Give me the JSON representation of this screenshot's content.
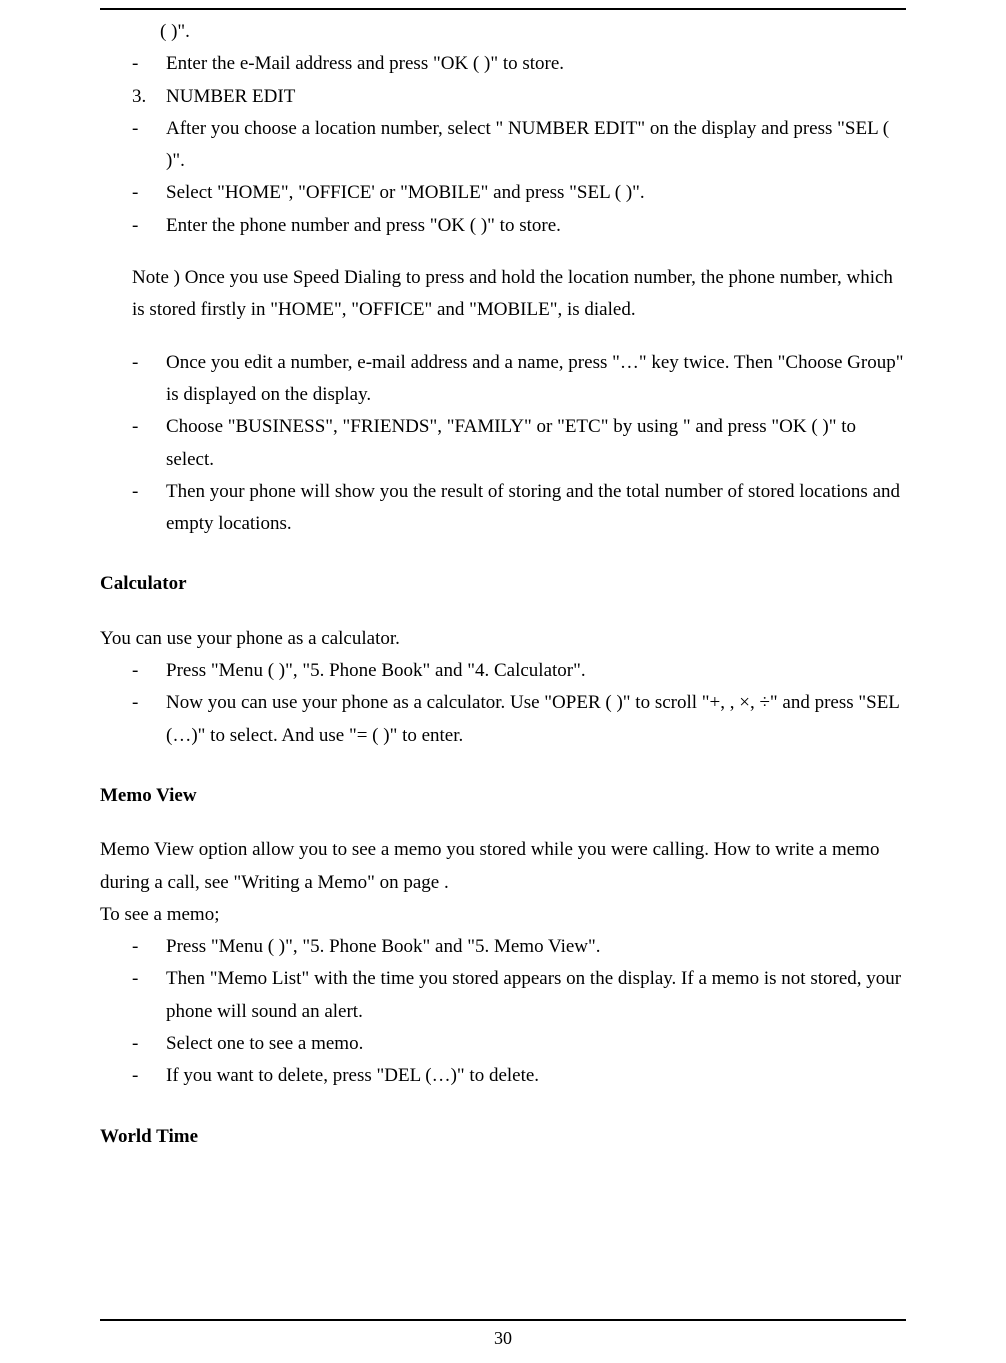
{
  "page_number": "30",
  "lines": {
    "a1": "(   )\".",
    "a2": "Enter the e-Mail address and press \"OK (   )\" to store.",
    "a3_num": "3.",
    "a3": "NUMBER EDIT",
    "a4": "After you choose a location number, select \"   NUMBER EDIT\" on the display and press \"SEL (   )\".",
    "a5": "Select \"HOME\", \"OFFICE' or \"MOBILE\" and press \"SEL (   )\".",
    "a6": "Enter the phone number and press \"OK (   )\" to store.",
    "note": "Note ) Once you use Speed Dialing to press and hold the location number, the phone number, which is stored firstly in \"HOME\", \"OFFICE\" and \"MOBILE\", is dialed.",
    "b1": "Once you edit a number, e-mail address and a name, press \"…\" key twice. Then \"Choose Group\" is displayed on the display.",
    "b2": "Choose \"BUSINESS\", \"FRIENDS\", \"FAMILY\" or \"ETC\" by using        \" and press \"OK (   )\" to select.",
    "b3": "Then your phone will show you the result of storing and the total number of stored locations and empty locations.",
    "calc_head": "Calculator",
    "calc_intro": "You can use your phone as a calculator.",
    "c1": "Press \"Menu (   )\", \"5. Phone Book\" and \"4. Calculator\".",
    "c2": "Now you can use your phone as a calculator. Use \"OPER (   )\" to scroll \"+,     ,  ×,  ÷\" and press \"SEL (…)\" to select. And use \"= (   )\" to enter.",
    "memo_head": "Memo View",
    "memo_intro": "Memo View option allow you to see a memo you stored while you were calling. How to write a memo during a call, see \"Writing a Memo\"  on  page       .",
    "memo_intro2": "To see a memo;",
    "m1": "Press \"Menu (   )\", \"5. Phone Book\" and \"5. Memo View\".",
    "m2": "Then \"Memo List\" with the time you stored appears on the display. If a memo is not stored, your phone will sound an alert.",
    "m3": "Select one to see a memo.",
    "m4": "If you want to delete, press \"DEL (…)\" to delete.",
    "world_head": "World Time"
  }
}
